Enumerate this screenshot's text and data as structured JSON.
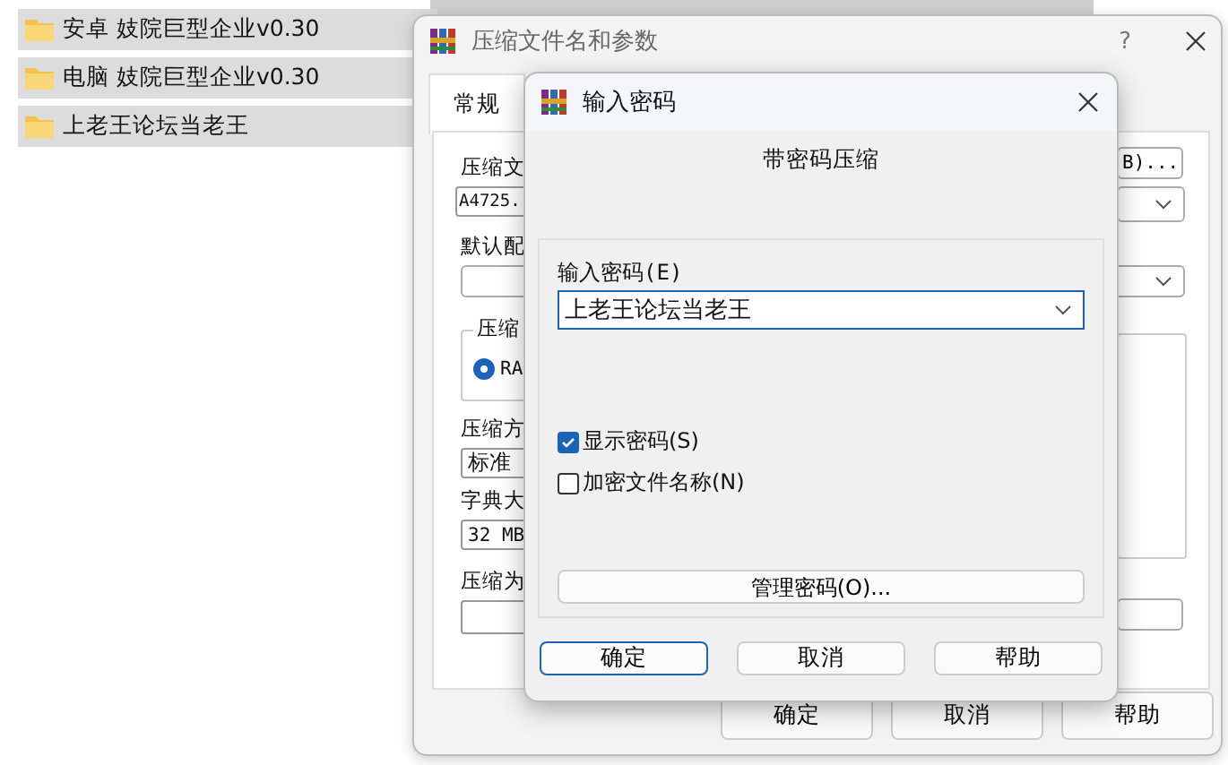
{
  "file_list": [
    {
      "name": "安卓 妓院巨型企业v0.30",
      "kind": "folder"
    },
    {
      "name": "电脑 妓院巨型企业v0.30",
      "kind": "folder"
    },
    {
      "name": "上老王论坛当老王",
      "kind": "folder"
    }
  ],
  "archive_dialog": {
    "title": "压缩文件名和参数",
    "help": "?",
    "tabs": [
      {
        "label": "常规",
        "selected": true
      }
    ],
    "archive_name_label": "压缩文",
    "archive_name_value": "A4725.",
    "browse_button": "B)...",
    "profile_label": "默认配",
    "format_group_label": "压缩",
    "format_radio": {
      "label": "RA",
      "selected": true
    },
    "method_label": "压缩方",
    "method_value": "标准",
    "dictionary_label": "字典大",
    "dictionary_value": "32 MB",
    "split_label": "压缩为",
    "buttons": [
      "确定",
      "取消",
      "帮助"
    ]
  },
  "password_dialog": {
    "title": "输入密码",
    "heading": "带密码压缩",
    "password_label": "输入密码(E)",
    "password_value": "上老王论坛当老王",
    "options": [
      {
        "label": "显示密码(S)",
        "checked": true
      },
      {
        "label": "加密文件名称(N)",
        "checked": false
      }
    ],
    "manage_button": "管理密码(O)...",
    "buttons": [
      {
        "label": "确定",
        "default": true
      },
      {
        "label": "取消",
        "default": false
      },
      {
        "label": "帮助",
        "default": false
      }
    ]
  }
}
